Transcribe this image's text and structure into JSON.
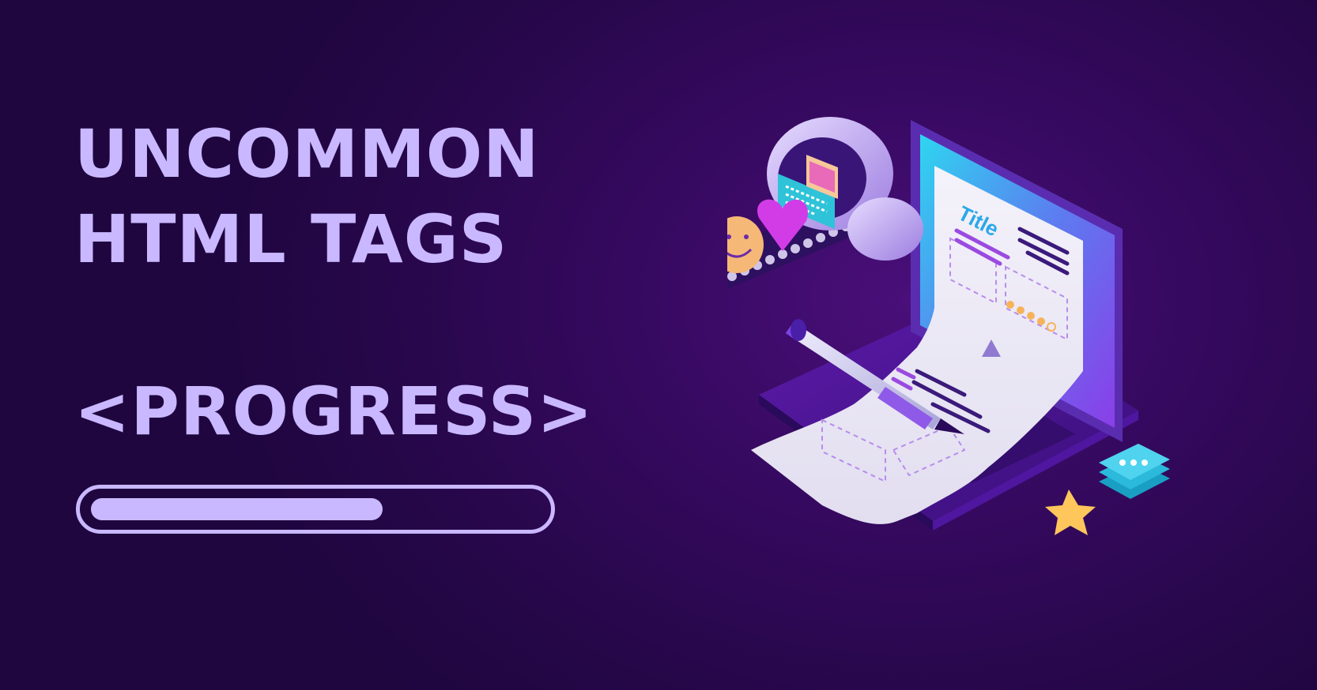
{
  "headline": {
    "line1": "UNCOMMON",
    "line2": "HTML TAGS",
    "tag": "<PROGRESS>"
  },
  "progress": {
    "fraction": 0.65
  },
  "illustration": {
    "doc_title": "Title"
  },
  "colors": {
    "accent": "#c9b8ff",
    "background": "#2a0850"
  }
}
